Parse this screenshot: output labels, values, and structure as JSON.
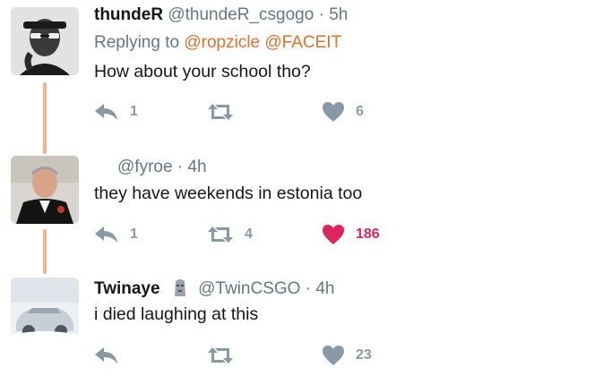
{
  "tweets": [
    {
      "name": "thundeR",
      "handle": "@thundeR_csgogo",
      "sep": "·",
      "time": "5h",
      "replying_prefix": "Replying to",
      "mentions": [
        "@ropzicle",
        "@FACEIT"
      ],
      "text": "How about your school tho?",
      "replies": "1",
      "retweets": "",
      "likes": "6",
      "liked": false
    },
    {
      "handle": "@fyroe",
      "sep": "·",
      "time": "4h",
      "text": "they have weekends in estonia too",
      "replies": "1",
      "retweets": "4",
      "likes": "186",
      "liked": true
    },
    {
      "name": "Twinaye",
      "badge_icon": "moai-emoji-icon",
      "handle": "@TwinCSGO",
      "sep": "·",
      "time": "4h",
      "text": "i died laughing at this",
      "replies": "",
      "retweets": "",
      "likes": "23",
      "liked": false
    }
  ],
  "colors": {
    "thread_line": "#f4b28c",
    "mention": "#e86f2c",
    "muted": "#657786",
    "icon": "#8899a6",
    "like_active": "#e0245e"
  }
}
